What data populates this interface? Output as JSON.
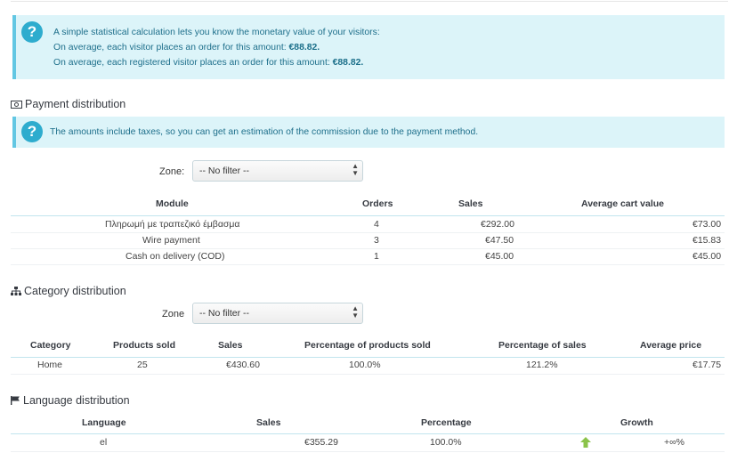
{
  "visitors_alert": {
    "line1": "A simple statistical calculation lets you know the monetary value of your visitors:",
    "line2_prefix": "On average, each visitor places an order for this amount: ",
    "line2_value": "€88.82.",
    "line3_prefix": "On average, each registered visitor places an order for this amount: ",
    "line3_value": "€88.82."
  },
  "payment": {
    "title": "Payment distribution",
    "info": "The amounts include taxes, so you can get an estimation of the commission due to the payment method.",
    "zone_label": "Zone:",
    "zone_value": "-- No filter --",
    "headers": {
      "module": "Module",
      "orders": "Orders",
      "sales": "Sales",
      "avg": "Average cart value"
    },
    "rows": [
      {
        "module": "Πληρωμή με τραπεζικό έμβασμα",
        "orders": "4",
        "sales": "€292.00",
        "avg": "€73.00"
      },
      {
        "module": "Wire payment",
        "orders": "3",
        "sales": "€47.50",
        "avg": "€15.83"
      },
      {
        "module": "Cash on delivery (COD)",
        "orders": "1",
        "sales": "€45.00",
        "avg": "€45.00"
      }
    ]
  },
  "category": {
    "title": "Category distribution",
    "zone_label": "Zone",
    "zone_value": "-- No filter --",
    "headers": {
      "category": "Category",
      "products_sold": "Products sold",
      "sales": "Sales",
      "pct_products": "Percentage of products sold",
      "pct_sales": "Percentage of sales",
      "avg_price": "Average price"
    },
    "rows": [
      {
        "category": "Home",
        "products_sold": "25",
        "sales": "€430.60",
        "pct_products": "100.0%",
        "pct_sales": "121.2%",
        "avg_price": "€17.75"
      }
    ]
  },
  "language": {
    "title": "Language distribution",
    "headers": {
      "language": "Language",
      "sales": "Sales",
      "percentage": "Percentage",
      "growth": "Growth"
    },
    "rows": [
      {
        "language": "el",
        "sales": "€355.29",
        "percentage": "100.0%",
        "growth": "+∞%"
      }
    ]
  },
  "colors": {
    "alert_bg": "#dcf4f9",
    "alert_border": "#62c7e3",
    "info_icon": "#2eacce",
    "growth_up": "#8bc34a"
  },
  "icons": {
    "alert": "question-icon",
    "payment": "money-icon",
    "category": "sitemap-icon",
    "language": "flag-icon",
    "growth": "arrow-up-icon",
    "select": "select-arrows-icon"
  }
}
